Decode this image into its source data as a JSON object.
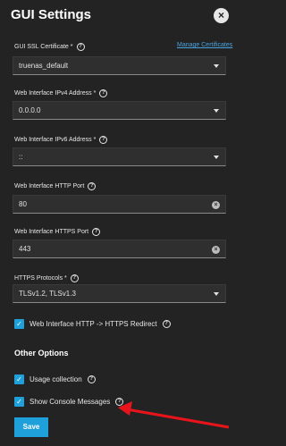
{
  "header": {
    "title": "GUI Settings",
    "close_symbol": "×"
  },
  "fields": {
    "ssl_cert": {
      "label": "GUI SSL Certificate *",
      "value": "truenas_default",
      "link": "Manage Certificates"
    },
    "ipv4": {
      "label": "Web Interface IPv4 Address *",
      "value": "0.0.0.0"
    },
    "ipv6": {
      "label": "Web Interface IPv6 Address *",
      "value": "::"
    },
    "http_port": {
      "label": "Web Interface HTTP Port",
      "value": "80"
    },
    "https_port": {
      "label": "Web Interface HTTPS Port",
      "value": "443"
    },
    "https_protocols": {
      "label": "HTTPS Protocols *",
      "value": "TLSv1.2, TLSv1.3"
    }
  },
  "checkboxes": {
    "redirect": {
      "label": "Web Interface HTTP -> HTTPS Redirect",
      "checked": true
    },
    "usage": {
      "label": "Usage collection",
      "checked": true
    },
    "console": {
      "label": "Show Console Messages",
      "checked": true
    }
  },
  "other_options": {
    "title": "Other Options"
  },
  "actions": {
    "save_label": "Save"
  },
  "icons": {
    "help": "?",
    "check": "✓",
    "clear": "×"
  },
  "colors": {
    "accent": "#1fa0da",
    "background": "#232323",
    "arrow": "#e8141c"
  }
}
